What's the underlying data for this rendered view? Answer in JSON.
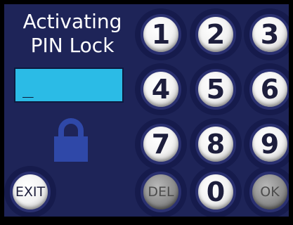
{
  "title": {
    "line1": "Activating",
    "line2": "PIN Lock"
  },
  "pin": {
    "value": "_"
  },
  "icons": {
    "lock": "padlock-icon"
  },
  "colors": {
    "background": "#1e2458",
    "display": "#2bbbe6",
    "lock": "#2f48a8",
    "key_light": "#f2f2f2",
    "key_dark": "#8c8c8c"
  },
  "keypad": {
    "k1": "1",
    "k2": "2",
    "k3": "3",
    "k4": "4",
    "k5": "5",
    "k6": "6",
    "k7": "7",
    "k8": "8",
    "k9": "9",
    "k0": "0",
    "del": "DEL",
    "ok": "OK"
  },
  "exit": {
    "label": "EXIT"
  }
}
